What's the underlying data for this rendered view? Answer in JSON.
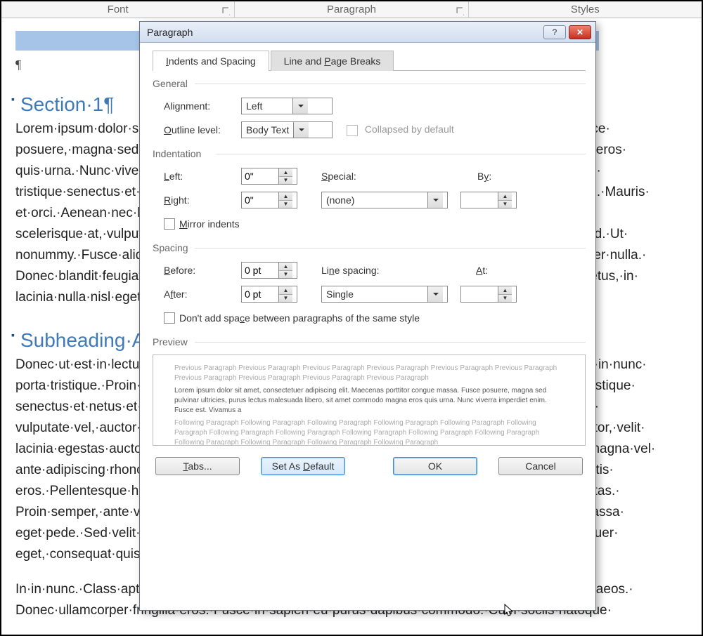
{
  "ribbon": {
    "font": "Font",
    "paragraph": "Paragraph",
    "styles": "Styles"
  },
  "document": {
    "heading1": "Section·1¶",
    "para1": "Lorem·ipsum·dolor·sit·amet,·consectetuer·adipiscing·elit.·Maecenas·porttitor·congue·massa.·Fusce· posuere,·magna·sed·pulvinar·ultricies,·purus·lectus·malesuada·libero,·sit·amet·commodo·magna·eros· quis·urna.·Nunc·viverra·imperdiet·enim.·Fusce·est.·Vivamus·a·tellus.·Pellentesque·habitant·morbi· tristique·senectus·et·netus·et·malesuada·fames·ac·turpis·egestas.·Proin·pharetra·nonummy·pede.·Mauris· et·orci.·Aenean·nec·lorem.·In·porttitor.·Donec·laoreet·nonummy·augue.·Suspendisse·dui·purus,· scelerisque·at,·vulputate·vitae,·pretium·mattis,·nunc.·Mauris·eget·neque·at·sem·venenatis·eleifend.·Ut· nonummy.·Fusce·aliquet·pede·non·pede.·Suspendisse·dapibus·lorem·pellentesque·magna.·Integer·nulla.· Donec·blandit·feugiat·ligula.·Donec·hendrerit,·felis·et·imperdiet·euismod,·purus·ipsum·pretium·metus,·in· lacinia·nulla·nisl·eget·sapien.·Donec·ut·est·in·lectus·consequat·consequat.·Etiam·eget·dui.¶",
    "heading2": "Subheading·A¶",
    "para2": "Donec·ut·est·in·lectus·consequat·consequat.·Etiam·eget·dui.·Aliquam·erat·volutpat.·Sed·at·lorem·in·nunc· porta·tristique.·Proin·nec·augue.·Quisque·aliquam·tempor·magna.·Pellentesque·habitant·morbi·tristique· senectus·et·netus·et·malesuada·fames·ac·turpis·egestas.·Nunc·ac·magna.·Maecenas·odio·dolor,· vulputate·vel,·auctor·ac,·accumsan·id,·felis.·Pellentesque·cursus·sagittis·felis.·Pellentesque·porttitor,·velit· lacinia·egestas·auctor,·diam·eros·tempus·arcu,·nec·vulputate·augue·magna·vel·risus.·Cras·non·magna·vel· ante·adipiscing·rhoncus.·Vivamus·a·mi.·Morbi·neque.·Aliquam·erat·volutpat.·Integer·ultrices·lobortis· eros.·Pellentesque·habitant·morbi·tristique·senectus·et·netus·et·malesuada·fames·ac·turpis·egestas.· Proin·semper,·ante·vitae·sollicitudin·posuere,·metus·quam·iaculis·nibh,·vitae·scelerisque·nunc·massa· eget·pede.·Sed·velit·urna,·interdum·vel,·ultricies·vel,·faucibus·at,·quam.·Donec·elit·est,·consectetuer· eget,·consequat·quis,·tempus·quis,·wisi.¶",
    "para3": "In·in·nunc.·Class·aptent·taciti·sociosqu·ad·litora·torquent·per·conubia·nostra,·per·inceptos·hymenaeos.· Donec·ullamcorper·fringilla·eros.·Fusce·in·sapien·eu·purus·dapibus·commodo.·Cum·sociis·natoque·"
  },
  "dialog": {
    "title": "Paragraph",
    "tabs": {
      "indents": "Indents and Spacing",
      "breaks": "Line and Page Breaks"
    },
    "general": {
      "group": "General",
      "alignment_label": "Alignment:",
      "alignment_value": "Left",
      "outline_label": "Outline level:",
      "outline_value": "Body Text",
      "collapsed_label": "Collapsed by default"
    },
    "indent": {
      "group": "Indentation",
      "left_label": "Left:",
      "left_value": "0\"",
      "right_label": "Right:",
      "right_value": "0\"",
      "special_label": "Special:",
      "special_value": "(none)",
      "by_label": "By:",
      "by_value": "",
      "mirror_label": "Mirror indents"
    },
    "spacing": {
      "group": "Spacing",
      "before_label": "Before:",
      "before_value": "0 pt",
      "after_label": "After:",
      "after_value": "0 pt",
      "line_label": "Line spacing:",
      "line_value": "Single",
      "at_label": "At:",
      "at_value": "",
      "noadd_label": "Don't add space between paragraphs of the same style"
    },
    "preview": {
      "group": "Preview",
      "prev_text": "Previous Paragraph Previous Paragraph Previous Paragraph Previous Paragraph Previous Paragraph Previous Paragraph Previous Paragraph Previous Paragraph Previous Paragraph Previous Paragraph",
      "sample_text": "Lorem ipsum dolor sit amet, consectetuer adipiscing elit. Maecenas porttitor congue massa. Fusce posuere, magna sed pulvinar ultricies, purus lectus malesuada libero, sit amet commodo magna eros quis urna. Nunc viverra imperdiet enim. Fusce est. Vivamus a",
      "next_text": "Following Paragraph Following Paragraph Following Paragraph Following Paragraph Following Paragraph Following Paragraph Following Paragraph Following Paragraph Following Paragraph Following Paragraph Following Paragraph Following Paragraph Following Paragraph Following Paragraph Following Paragraph"
    },
    "buttons": {
      "tabs": "Tabs...",
      "setdefault": "Set As Default",
      "ok": "OK",
      "cancel": "Cancel"
    }
  }
}
